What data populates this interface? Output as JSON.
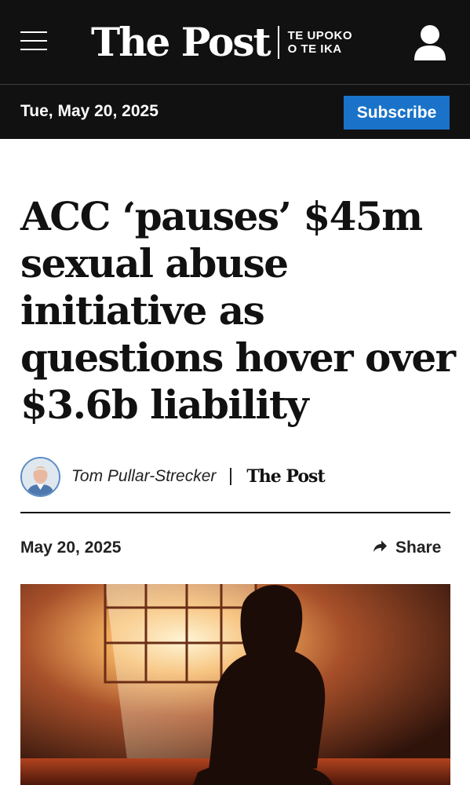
{
  "header": {
    "brand_name": "The Post",
    "brand_sub": "TE UPOKO O TE IKA",
    "menu_icon": "hamburger-menu-icon",
    "account_icon": "user-account-icon"
  },
  "datebar": {
    "date": "Tue, May 20, 2025",
    "subscribe_label": "Subscribe"
  },
  "article": {
    "headline": "ACC ‘pauses’ $45m sexual abuse initiative as questions hover over $3.6b liability",
    "author": "Tom Pullar-Strecker",
    "publication": "The Post",
    "date": "May 20, 2025",
    "share_label": "Share",
    "share_icon": "share-arrow-icon"
  },
  "colors": {
    "header_bg": "#111111",
    "accent": "#1a73c8",
    "text": "#111111"
  }
}
